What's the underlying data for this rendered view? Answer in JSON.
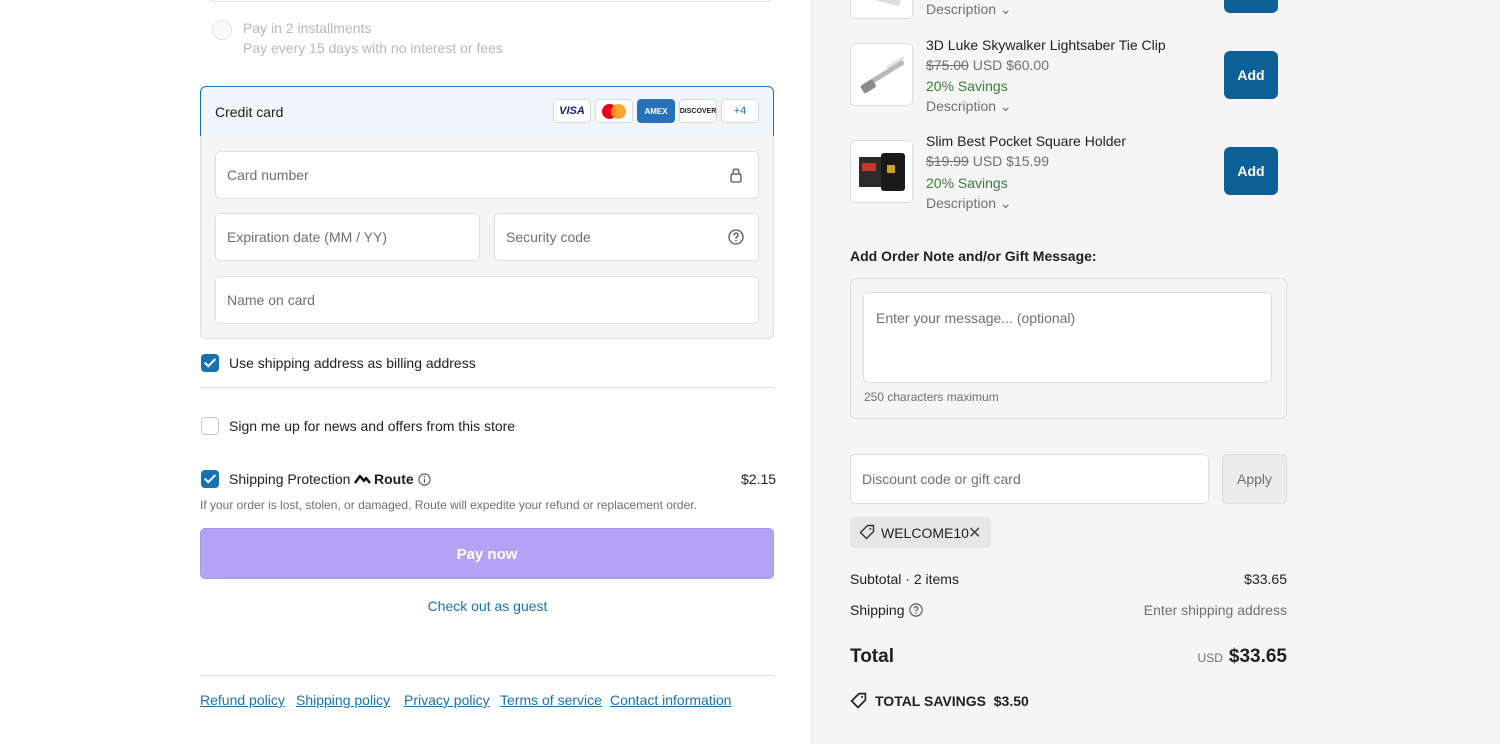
{
  "installments": {
    "title": "Pay in 2 installments",
    "subtitle": "Pay every 15 days with no interest or fees"
  },
  "credit_card": {
    "label": "Credit card",
    "brands": [
      "VISA",
      "mastercard",
      "AMEX",
      "DISCOVER"
    ],
    "more_brands": "+4",
    "card_number_placeholder": "Card number",
    "expiry_placeholder": "Expiration date (MM / YY)",
    "security_placeholder": "Security code",
    "name_placeholder": "Name on card"
  },
  "billing": {
    "label": "Use shipping address as billing address",
    "checked": true
  },
  "newsletter": {
    "label": "Sign me up for news and offers from this store",
    "checked": false
  },
  "protection": {
    "label": "Shipping Protection",
    "brand": "Route",
    "price": "$2.15",
    "note": "If your order is lost, stolen, or damaged, Route will expedite your refund or replacement order.",
    "checked": true
  },
  "pay_button": "Pay now",
  "guest_link": "Check out as guest",
  "footer": [
    "Refund policy",
    "Shipping policy",
    "Privacy policy",
    "Terms of service",
    "Contact information"
  ],
  "upsells": {
    "top_desc": "Description",
    "items": [
      {
        "name": "3D Luke Skywalker Lightsaber Tie Clip",
        "old_price": "$75.00",
        "currency": "USD",
        "price": "$60.00",
        "savings": "20% Savings",
        "desc": "Description",
        "add": "Add"
      },
      {
        "name": "Slim Best Pocket Square Holder",
        "old_price": "$19.99",
        "currency": "USD",
        "price": "$15.99",
        "savings": "20% Savings",
        "desc": "Description",
        "add": "Add"
      }
    ]
  },
  "note": {
    "title": "Add Order Note and/or Gift Message:",
    "placeholder": "Enter your message... (optional)",
    "max": "250 characters maximum"
  },
  "discount": {
    "placeholder": "Discount code or gift card",
    "apply": "Apply",
    "applied_code": "WELCOME10"
  },
  "summary": {
    "subtotal_label": "Subtotal · 2 items",
    "subtotal_value": "$33.65",
    "shipping_label": "Shipping",
    "shipping_value": "Enter shipping address",
    "total_label": "Total",
    "total_currency": "USD",
    "total_value": "$33.65",
    "savings_label": "TOTAL SAVINGS",
    "savings_value": "$3.50"
  },
  "colors": {
    "accent": "#1773b0",
    "pay_button": "#b3a3f5",
    "add_button": "#0e6196",
    "savings_green": "#3a7d3a"
  }
}
